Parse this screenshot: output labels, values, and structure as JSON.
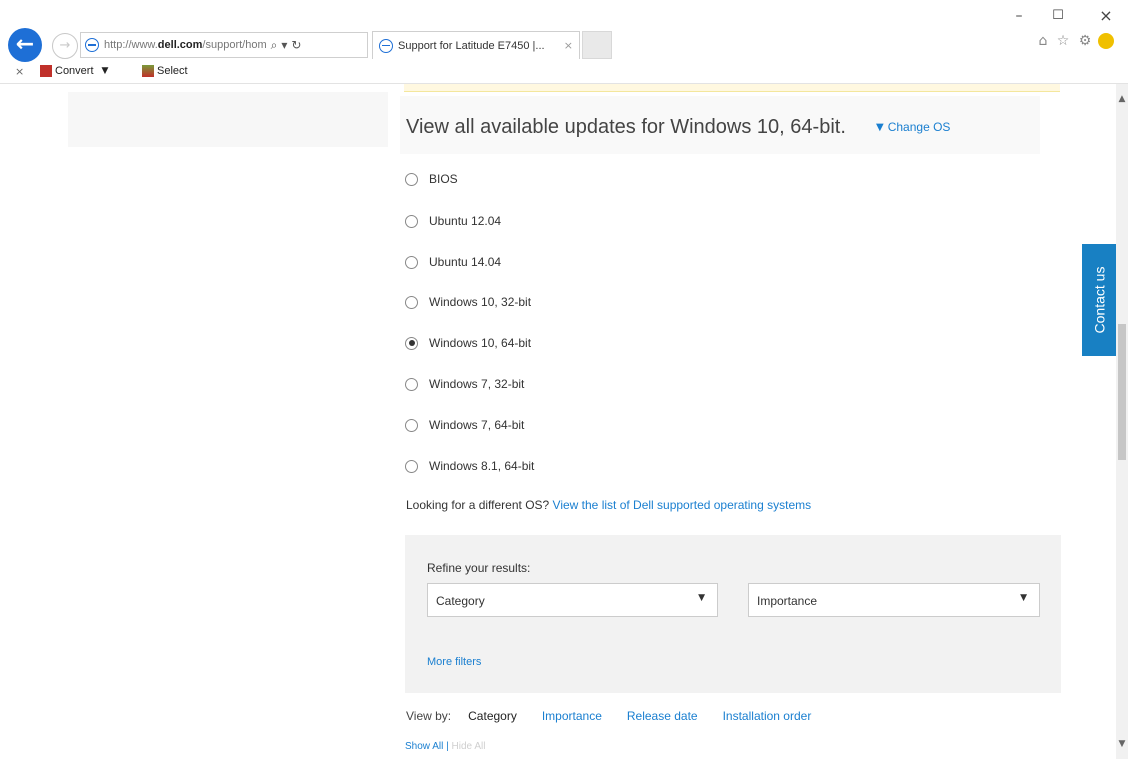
{
  "browser": {
    "address": {
      "prefix": "http://www.",
      "domain": "dell.com",
      "path": "/support/hom"
    },
    "address_icons": {
      "search": "⌕",
      "dropdown": "▾",
      "refresh": "↻"
    },
    "tab": {
      "title": "Support for Latitude E7450 |...",
      "close": "×"
    },
    "window": {
      "minimize": "–",
      "maximize": "☐",
      "close": "×"
    },
    "toolbar_icons": {
      "home": "⌂",
      "favorites": "☆",
      "settings": "⚙"
    },
    "nav": {
      "back": "←",
      "forward": "→"
    }
  },
  "command_bar": {
    "close": "×",
    "convert": "Convert",
    "convert_caret": "▼",
    "select": "Select"
  },
  "content": {
    "headline": "View all available updates for Windows 10, 64-bit.",
    "change_os": "Change OS",
    "change_os_caret": "▼",
    "os_options": [
      {
        "label": "BIOS",
        "selected": false
      },
      {
        "label": "Ubuntu 12.04",
        "selected": false
      },
      {
        "label": "Ubuntu 14.04",
        "selected": false
      },
      {
        "label": "Windows 10, 32-bit",
        "selected": false
      },
      {
        "label": "Windows 10, 64-bit",
        "selected": true
      },
      {
        "label": "Windows 7, 32-bit",
        "selected": false
      },
      {
        "label": "Windows 7, 64-bit",
        "selected": false
      },
      {
        "label": "Windows 8.1, 64-bit",
        "selected": false
      }
    ],
    "different_os_text": "Looking for a different OS?",
    "different_os_link": "View the list of Dell supported operating systems",
    "refine": {
      "label": "Refine your results:",
      "category": "Category",
      "importance": "Importance",
      "caret": "▼",
      "more_filters": "More filters"
    },
    "view_by": {
      "label": "View by:",
      "options": [
        "Category",
        "Importance",
        "Release date",
        "Installation order"
      ]
    },
    "show_all": "Show All",
    "separator": "|",
    "hide_all": "Hide All",
    "contact_us": "Contact us"
  },
  "scrollbar": {
    "up": "▲",
    "down": "▼"
  },
  "colors": {
    "link": "#1a7fd0",
    "contact_tab": "#1880c3",
    "back_button": "#1e6fd6"
  }
}
